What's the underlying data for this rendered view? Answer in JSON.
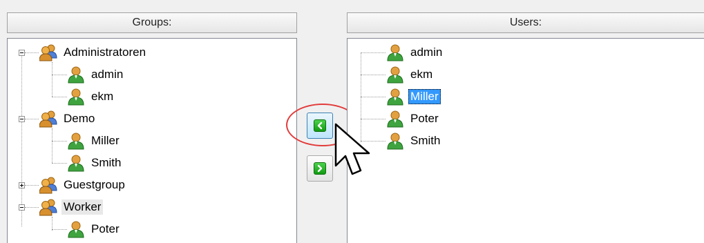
{
  "groups_panel": {
    "header": "Groups:",
    "tree": [
      {
        "label": "Administratoren",
        "type": "group",
        "expanded": true,
        "children": [
          {
            "label": "admin",
            "type": "user"
          },
          {
            "label": "ekm",
            "type": "user"
          }
        ]
      },
      {
        "label": "Demo",
        "type": "group",
        "expanded": true,
        "children": [
          {
            "label": "Miller",
            "type": "user"
          },
          {
            "label": "Smith",
            "type": "user"
          }
        ]
      },
      {
        "label": "Guestgroup",
        "type": "group",
        "expanded": false,
        "children": []
      },
      {
        "label": "Worker",
        "type": "group",
        "expanded": true,
        "children": [
          {
            "label": "Poter",
            "type": "user"
          }
        ]
      }
    ]
  },
  "users_panel": {
    "header": "Users:",
    "items": [
      {
        "label": "admin"
      },
      {
        "label": "ekm"
      },
      {
        "label": "Miller",
        "selected": true
      },
      {
        "label": "Poter"
      },
      {
        "label": "Smith"
      }
    ]
  },
  "buttons": {
    "add_to_group": {
      "icon": "green-arrow-left-icon",
      "state": "pressed"
    },
    "remove_from_group": {
      "icon": "green-arrow-right-icon",
      "state": "normal"
    }
  },
  "annotation": {
    "color": "#e23b3b",
    "shape": "ellipse"
  },
  "colors": {
    "selection": "#3399ff",
    "group_icon": "#cc8a2e",
    "user_icon": "#3fa43f"
  }
}
